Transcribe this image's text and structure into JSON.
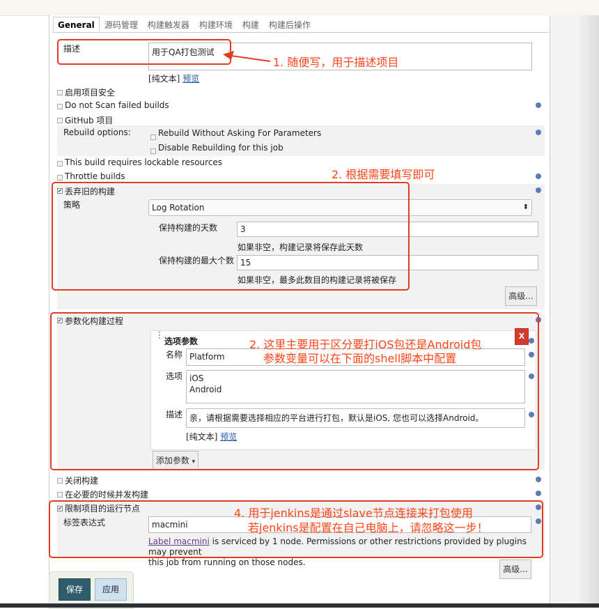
{
  "tabs": [
    "General",
    "源码管理",
    "构建触发器",
    "构建环境",
    "构建",
    "构建后操作"
  ],
  "description": {
    "label": "描述",
    "value": "用于QA打包测试",
    "plain_text": "[纯文本]",
    "preview": "预览"
  },
  "options": {
    "project_security": "启用项目安全",
    "no_scan_failed": "Do not Scan failed builds",
    "github_project": "GitHub 项目",
    "rebuild_options_label": "Rebuild options:",
    "rebuild_without_asking": "Rebuild Without Asking For Parameters",
    "disable_rebuilding": "Disable Rebuilding for this job",
    "lockable_resources": "This build requires lockable resources",
    "throttle_builds": "Throttle builds",
    "discard_old_builds": "丢弃旧的构建"
  },
  "discard": {
    "strategy_label": "策略",
    "strategy_value": "Log Rotation",
    "days_label": "保持构建的天数",
    "days_value": "3",
    "days_hint": "如果非空，构建记录将保存此天数",
    "max_label": "保持构建的最大个数",
    "max_value": "15",
    "max_hint": "如果非空，最多此数目的构建记录将被保存",
    "advanced": "高级..."
  },
  "parameterized": {
    "label": "参数化构建过程",
    "param_title": "选项参数",
    "name_label": "名称",
    "name_value": "Platform",
    "choices_label": "选项",
    "choices": [
      "iOS",
      "Android"
    ],
    "desc_label": "描述",
    "desc_value": "亲，请根据需要选择相应的平台进行打包，默认是iOS, 您也可以选择Android。",
    "plain_text": "[纯文本]",
    "preview": "预览",
    "add_param": "添加参数",
    "delete": "X"
  },
  "more_options": {
    "disable_build": "关闭构建",
    "concurrent_build": "在必要的时候并发构建",
    "restrict_node": "限制项目的运行节点"
  },
  "label": {
    "expr_label": "标签表达式",
    "expr_value": "macmini",
    "link_text": "Label macmini",
    "info_line1": " is serviced by 1 node. Permissions or other restrictions provided by plugins may prevent",
    "info_line2": "this job from running on those nodes.",
    "advanced": "高级..."
  },
  "buttons": {
    "save": "保存",
    "apply": "应用"
  },
  "annotations": {
    "a1": "1. 随便写，用于描述项目",
    "a2": "2. 根据需要填写即可",
    "a3_line1": "2. 这里主要用于区分要打iOS包还是Android包",
    "a3_line2": "参数变量可以在下面的shell脚本中配置",
    "a4_line1": "4. 用于jenkins是通过slave节点连接来打包使用",
    "a4_line2": "若jenkins是配置在自己电脑上，请忽略这一步！"
  },
  "colors": {
    "annotation_red": "#e43c1f",
    "save_button": "#2f5d6e",
    "apply_button": "#cfe0ee",
    "help_icon": "#5a7bb3"
  }
}
